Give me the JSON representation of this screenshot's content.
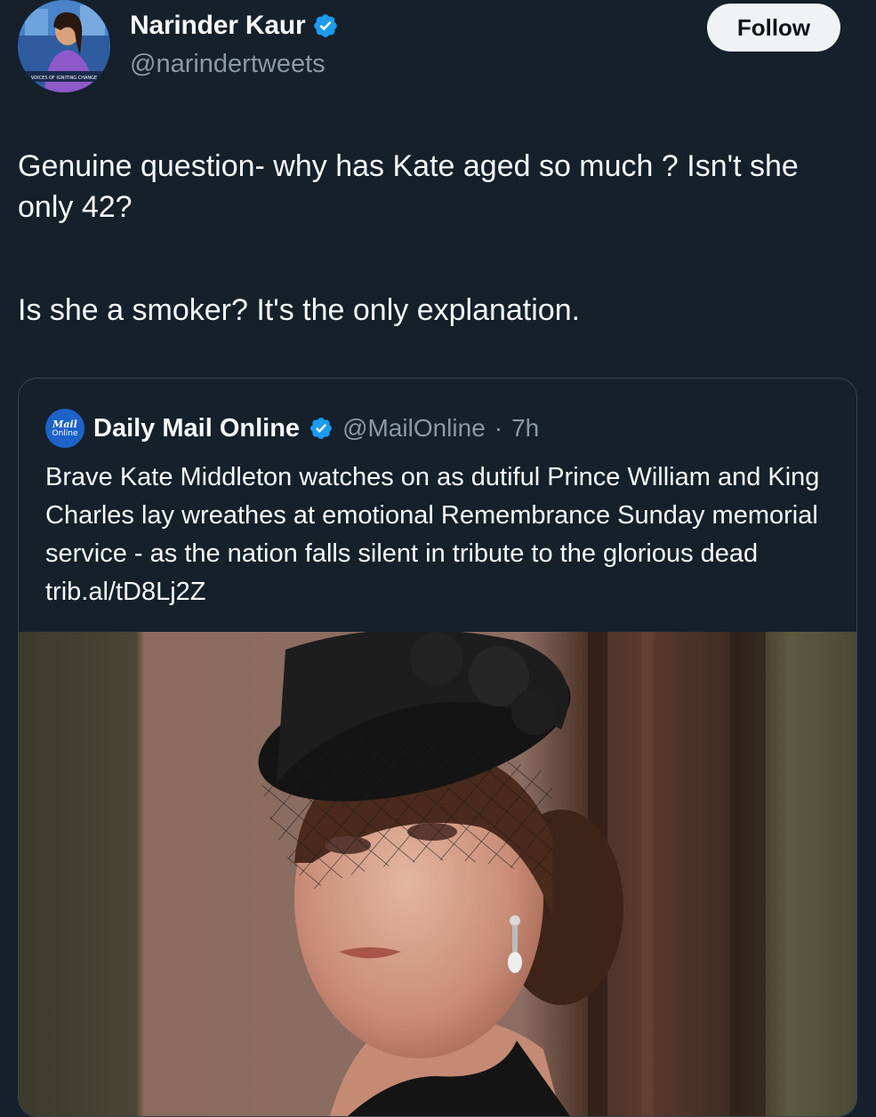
{
  "author": {
    "display_name": "Narinder Kaur",
    "handle": "@narindertweets",
    "verified": true,
    "avatar_caption": "VOICES OF IGNITING CHANGE"
  },
  "follow_button": {
    "label": "Follow"
  },
  "tweet": {
    "paragraphs": [
      "Genuine question- why has Kate aged so much ? Isn't she only 42?",
      "Is she a smoker? It's the only explanation."
    ]
  },
  "quoted_tweet": {
    "avatar_text_top": "Mail",
    "avatar_text_bottom": "Online",
    "display_name": "Daily Mail Online",
    "verified": true,
    "handle": "@MailOnline",
    "separator": "·",
    "time": "7h",
    "text": "Brave Kate Middleton watches on as dutiful Prince William and King Charles lay wreathes at emotional Remembrance Sunday memorial service - as the nation falls silent in tribute to the glorious dead trib.al/tD8Lj2Z",
    "media": {
      "type": "photo",
      "description_icon": "photo-icon"
    }
  },
  "colors": {
    "background": "#15202b",
    "text_primary": "#f7f9f9",
    "text_secondary": "#8b98a5",
    "border": "#38444d",
    "verified_blue": "#1d9bf0",
    "follow_bg": "#eff3f4"
  }
}
